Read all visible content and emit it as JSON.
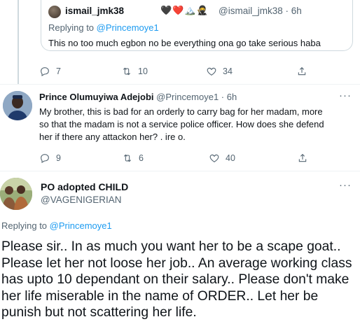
{
  "quoted_reply": {
    "name": "ismail_jmk38",
    "emoji": "🖤❤️🏔️🥷",
    "handle_time": "@ismail_jmk38 · 6h",
    "replying_prefix": "Replying to ",
    "replying_to": "@Princemoye1",
    "text": "This no too much egbon no be everything ona go take serious haba",
    "actions": {
      "replies": "7",
      "retweets": "10",
      "likes": "34"
    }
  },
  "tweet_2": {
    "name": "Prince Olumuyiwa Adejobi",
    "handle_time": "@Princemoye1 · 6h",
    "more": "···",
    "text": "My brother, this is bad for an orderly to carry bag for her madam, more so that the madam is not a service police officer. How does she defend her if there any attackon her? . ire o.",
    "actions": {
      "replies": "9",
      "retweets": "6",
      "likes": "40"
    }
  },
  "tweet_3": {
    "name": "PO adopted CHILD",
    "handle": "@VAGENIGERIAN",
    "more": "···",
    "replying_prefix": "Replying to ",
    "replying_to": "@Princemoye1",
    "text": "Please sir.. In as much you want her to be a scape goat.. Please let her not loose her job.. An average working class has upto 10 dependant on their salary.. Please don't make her life miserable in the name of ORDER.. Let her be punish but not scattering her life."
  },
  "icons": [
    "reply-icon",
    "retweet-icon",
    "like-icon",
    "share-icon",
    "more-icon"
  ]
}
